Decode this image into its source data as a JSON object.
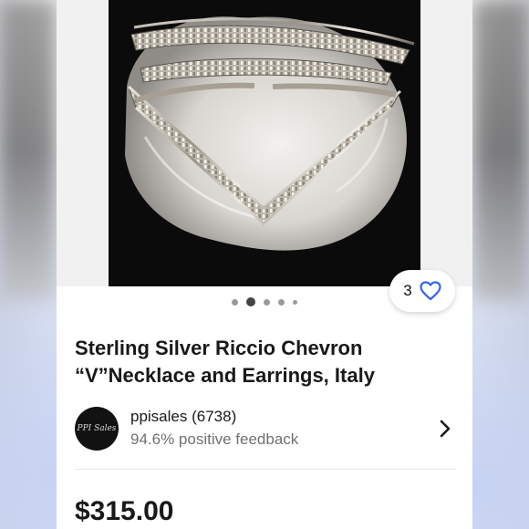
{
  "listing": {
    "title": "Sterling Silver Riccio Chevron “V”Necklace and Earrings, Italy",
    "watch_count": "3",
    "image_dots": {
      "count": 5,
      "active_index": 1
    }
  },
  "seller": {
    "avatar_text": "PPI Sales",
    "name": "ppisales (6738)",
    "feedback": "94.6% positive feedback"
  },
  "price": "$315.00",
  "colors": {
    "heart": "#3665f3",
    "text": "#191919",
    "muted": "#707070"
  },
  "icons": [
    "heart-icon",
    "chevron-right-icon"
  ]
}
